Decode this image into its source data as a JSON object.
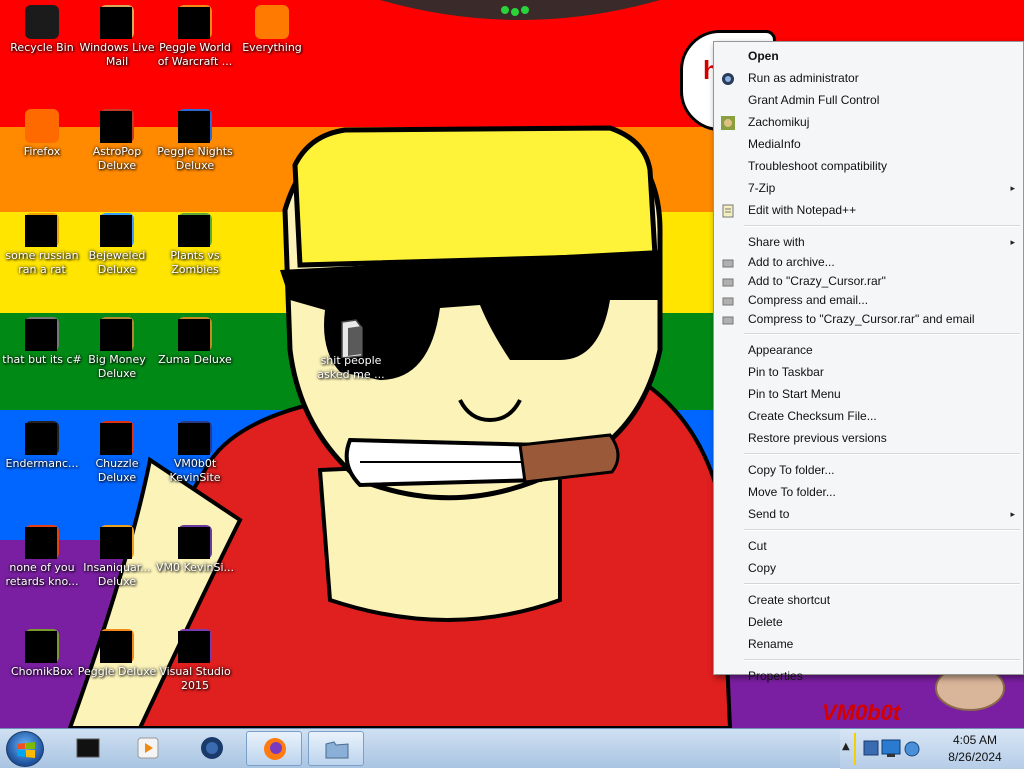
{
  "desktop": {
    "icons": [
      {
        "label": "Recycle Bin",
        "icon": "recycle-bin-icon",
        "color": "#1b1b1b"
      },
      {
        "label": "Windows Live Mail",
        "icon": "mail-icon",
        "color": "#d9a85a"
      },
      {
        "label": "Peggle World of Warcraft ...",
        "icon": "peggle-icon",
        "color": "#f08a1a"
      },
      {
        "label": "Everything",
        "icon": "search-icon",
        "color": "#ff7a00"
      },
      {
        "label": "Firefox",
        "icon": "firefox-icon",
        "color": "#ff6a00"
      },
      {
        "label": "AstroPop Deluxe",
        "icon": "game-icon",
        "color": "#c23a2a"
      },
      {
        "label": "Peggle Nights Deluxe",
        "icon": "peggle-icon",
        "color": "#2b6bd1"
      },
      {
        "label": "some russian ran a rat",
        "icon": "app-icon",
        "color": "#f0a000"
      },
      {
        "label": "Bejeweled Deluxe",
        "icon": "gem-icon",
        "color": "#3aa0ff"
      },
      {
        "label": "Plants vs Zombies",
        "icon": "game-icon",
        "color": "#5fa83a"
      },
      {
        "label": "that but its c#",
        "icon": "folder-icon",
        "color": "#777777"
      },
      {
        "label": "Big Money Deluxe",
        "icon": "money-icon",
        "color": "#b08a30"
      },
      {
        "label": "Zuma Deluxe",
        "icon": "game-icon",
        "color": "#c58a20"
      },
      {
        "label": "Endermanc...",
        "icon": "terminal-icon",
        "color": "#222222"
      },
      {
        "label": "Chuzzle Deluxe",
        "icon": "game-icon",
        "color": "#e03010"
      },
      {
        "label": "VM0b0t KevinSite",
        "icon": "app-icon",
        "color": "#2a3a8a"
      },
      {
        "label": "none of you retards kno...",
        "icon": "app-icon",
        "color": "#e84010"
      },
      {
        "label": "Insaniquar... Deluxe",
        "icon": "fish-icon",
        "color": "#f0a020"
      },
      {
        "label": "VM0 KevinSi...",
        "icon": "app-icon",
        "color": "#6a3aa0"
      },
      {
        "label": "ChomikBox",
        "icon": "hamster-icon",
        "color": "#7a9a30"
      },
      {
        "label": "Peggle Deluxe",
        "icon": "peggle-icon",
        "color": "#f08a1a"
      },
      {
        "label": "Visual Studio 2015",
        "icon": "visual-studio-icon",
        "color": "#7a3ab0"
      }
    ],
    "selected_file": {
      "label": "shit people asked me ...",
      "icon": "file-icon"
    },
    "bubble_text": "h e",
    "wallpaper_text": "VM0b0t"
  },
  "context_menu": {
    "items": [
      {
        "label": "Open",
        "bold": true,
        "icon": ""
      },
      {
        "label": "Run as administrator",
        "icon": "shield-icon"
      },
      {
        "label": "Grant Admin Full Control",
        "icon": ""
      },
      {
        "label": "Zachomikuj",
        "icon": "chomik-icon"
      },
      {
        "label": "MediaInfo",
        "icon": ""
      },
      {
        "label": "Troubleshoot compatibility",
        "icon": ""
      },
      {
        "label": "7-Zip",
        "icon": "",
        "submenu": true
      },
      {
        "label": "Edit with Notepad++",
        "icon": "notepad-icon"
      },
      {
        "sep": true
      },
      {
        "label": "Share with",
        "icon": "",
        "submenu": true
      },
      {
        "label": "Add to archive...",
        "icon": "archive-icon",
        "small": true
      },
      {
        "label": "Add to \"Crazy_Cursor.rar\"",
        "icon": "archive-icon",
        "small": true
      },
      {
        "label": "Compress and email...",
        "icon": "archive-icon",
        "small": true
      },
      {
        "label": "Compress to \"Crazy_Cursor.rar\" and email",
        "icon": "archive-icon",
        "small": true
      },
      {
        "sep": true
      },
      {
        "label": "Appearance",
        "icon": ""
      },
      {
        "label": "Pin to Taskbar",
        "icon": ""
      },
      {
        "label": "Pin to Start Menu",
        "icon": ""
      },
      {
        "label": "Create Checksum File...",
        "icon": ""
      },
      {
        "label": "Restore previous versions",
        "icon": ""
      },
      {
        "sep": true
      },
      {
        "label": "Copy To folder...",
        "icon": ""
      },
      {
        "label": "Move To folder...",
        "icon": ""
      },
      {
        "label": "Send to",
        "icon": "",
        "submenu": true
      },
      {
        "sep": true
      },
      {
        "label": "Cut",
        "icon": ""
      },
      {
        "label": "Copy",
        "icon": ""
      },
      {
        "sep": true
      },
      {
        "label": "Create shortcut",
        "icon": ""
      },
      {
        "label": "Delete",
        "icon": ""
      },
      {
        "label": "Rename",
        "icon": ""
      },
      {
        "sep": true
      },
      {
        "label": "Properties",
        "icon": ""
      }
    ],
    "submenu_arrow": "▸"
  },
  "taskbar": {
    "start_label": "Start",
    "pinned": [
      {
        "name": "terminal",
        "icon": "terminal-icon"
      },
      {
        "name": "media-player",
        "icon": "media-player-icon"
      },
      {
        "name": "globe",
        "icon": "globe-icon"
      },
      {
        "name": "firefox",
        "icon": "firefox-icon",
        "active": true
      },
      {
        "name": "explorer",
        "icon": "folder-icon",
        "active": true
      }
    ],
    "tray_chevron": "▲",
    "clock_time": "4:05 AM",
    "clock_date": "8/26/2024"
  }
}
